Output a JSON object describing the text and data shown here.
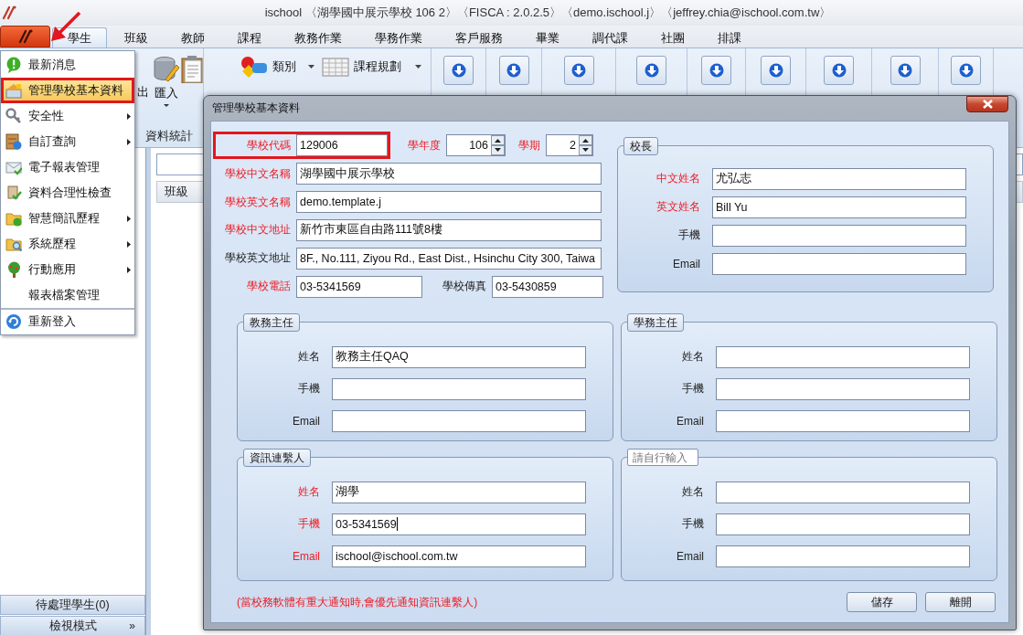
{
  "window": {
    "title": "ischool 〈湖學國中展示學校 106 2〉〈FISCA : 2.0.2.5〉〈demo.ischool.j〉〈jeffrey.chia@ischool.com.tw〉"
  },
  "tabs": [
    {
      "label": "學生",
      "selected": true
    },
    {
      "label": "班級",
      "selected": false
    },
    {
      "label": "教師",
      "selected": false
    },
    {
      "label": "課程",
      "selected": false
    },
    {
      "label": "教務作業",
      "selected": false
    },
    {
      "label": "學務作業",
      "selected": false
    },
    {
      "label": "客戶服務",
      "selected": false
    },
    {
      "label": "畢業",
      "selected": false
    },
    {
      "label": "調代課",
      "selected": false
    },
    {
      "label": "社團",
      "selected": false
    },
    {
      "label": "排課",
      "selected": false
    }
  ],
  "ribbon": {
    "buttons": [
      {
        "label": "出"
      },
      {
        "label": "匯入"
      }
    ],
    "group_label": "資料統計",
    "dropdowns": [
      {
        "label": "類別"
      },
      {
        "label": "課程規劃"
      }
    ]
  },
  "list_pane": {
    "column": "班級",
    "footer": [
      {
        "label": "待處理學生(0)"
      },
      {
        "label": "檢視模式",
        "glyph": "»"
      }
    ]
  },
  "app_menu": {
    "items": [
      {
        "label": "最新消息",
        "selected": false,
        "submenu": false,
        "annotated": false,
        "separator": false
      },
      {
        "label": "管理學校基本資料",
        "selected": true,
        "submenu": false,
        "annotated": true,
        "separator": false
      },
      {
        "label": "安全性",
        "selected": false,
        "submenu": true,
        "annotated": false,
        "separator": false
      },
      {
        "label": "自訂查詢",
        "selected": false,
        "submenu": true,
        "annotated": false,
        "separator": false
      },
      {
        "label": "電子報表管理",
        "selected": false,
        "submenu": false,
        "annotated": false,
        "separator": false
      },
      {
        "label": "資料合理性檢查",
        "selected": false,
        "submenu": false,
        "annotated": false,
        "separator": false
      },
      {
        "label": "智慧簡訊歷程",
        "selected": false,
        "submenu": true,
        "annotated": false,
        "separator": false
      },
      {
        "label": "系統歷程",
        "selected": false,
        "submenu": true,
        "annotated": false,
        "separator": false
      },
      {
        "label": "行動應用",
        "selected": false,
        "submenu": true,
        "annotated": false,
        "separator": false
      },
      {
        "label": "報表檔案管理",
        "selected": false,
        "submenu": false,
        "annotated": false,
        "separator": false
      },
      {
        "label": "重新登入",
        "selected": false,
        "submenu": false,
        "annotated": false,
        "separator": true
      }
    ]
  },
  "dialog": {
    "title": "管理學校基本資料",
    "rows": [
      [
        {
          "kind": "text",
          "label": "學校代碼",
          "value": "129006",
          "required": true,
          "annotated": true
        },
        {
          "kind": "spin",
          "label": "學年度",
          "value": "106",
          "required": true,
          "annotated": false
        },
        {
          "kind": "spin",
          "label": "學期",
          "value": "2",
          "required": true,
          "annotated": false
        }
      ],
      [
        {
          "kind": "text",
          "label": "學校中文名稱",
          "value": "湖學國中展示學校",
          "required": true,
          "annotated": false
        }
      ],
      [
        {
          "kind": "text",
          "label": "學校英文名稱",
          "value": "demo.template.j",
          "required": true,
          "annotated": false
        }
      ],
      [
        {
          "kind": "text",
          "label": "學校中文地址",
          "value": "新竹市東區自由路111號8樓",
          "required": true,
          "annotated": false
        }
      ],
      [
        {
          "kind": "text",
          "label": "學校英文地址",
          "value": "8F., No.111, Ziyou Rd., East Dist., Hsinchu City 300, Taiwa",
          "required": false,
          "annotated": false
        }
      ],
      [
        {
          "kind": "text",
          "label": "學校電話",
          "value": "03-5341569",
          "required": true,
          "annotated": false
        },
        {
          "kind": "text",
          "label": "學校傳真",
          "value": "03-5430859",
          "required": false,
          "annotated": false
        }
      ]
    ],
    "groups": [
      {
        "title": "校長",
        "fields": [
          {
            "label": "中文姓名",
            "value": "尤弘志",
            "required": true
          },
          {
            "label": "英文姓名",
            "value": "Bill Yu",
            "required": true
          },
          {
            "label": "手機",
            "required": false
          },
          {
            "label": "Email",
            "required": false
          }
        ]
      },
      {
        "title": "教務主任",
        "fields": [
          {
            "label": "姓名",
            "value": "教務主任QAQ",
            "required": false
          },
          {
            "label": "手機",
            "required": false
          },
          {
            "label": "Email",
            "required": false
          }
        ]
      },
      {
        "title": "學務主任",
        "fields": [
          {
            "label": "姓名",
            "required": false
          },
          {
            "label": "手機",
            "required": false
          },
          {
            "label": "Email",
            "required": false
          }
        ]
      },
      {
        "title": "資訊連繫人",
        "fields": [
          {
            "label": "姓名",
            "value": "湖學",
            "required": true
          },
          {
            "label": "手機",
            "value": "03-5341569",
            "required": true
          },
          {
            "label": "Email",
            "value": "ischool@ischool.com.tw",
            "required": true
          }
        ]
      },
      {
        "placeholder": "請自行輸入",
        "fields": [
          {
            "label": "姓名",
            "required": false
          },
          {
            "label": "手機",
            "required": false
          },
          {
            "label": "Email",
            "required": false
          }
        ]
      }
    ],
    "note": "(當校務軟體有重大通知時,會優先通知資訊連繫人)",
    "buttons": [
      {
        "label": "儲存"
      },
      {
        "label": "離開"
      }
    ]
  }
}
